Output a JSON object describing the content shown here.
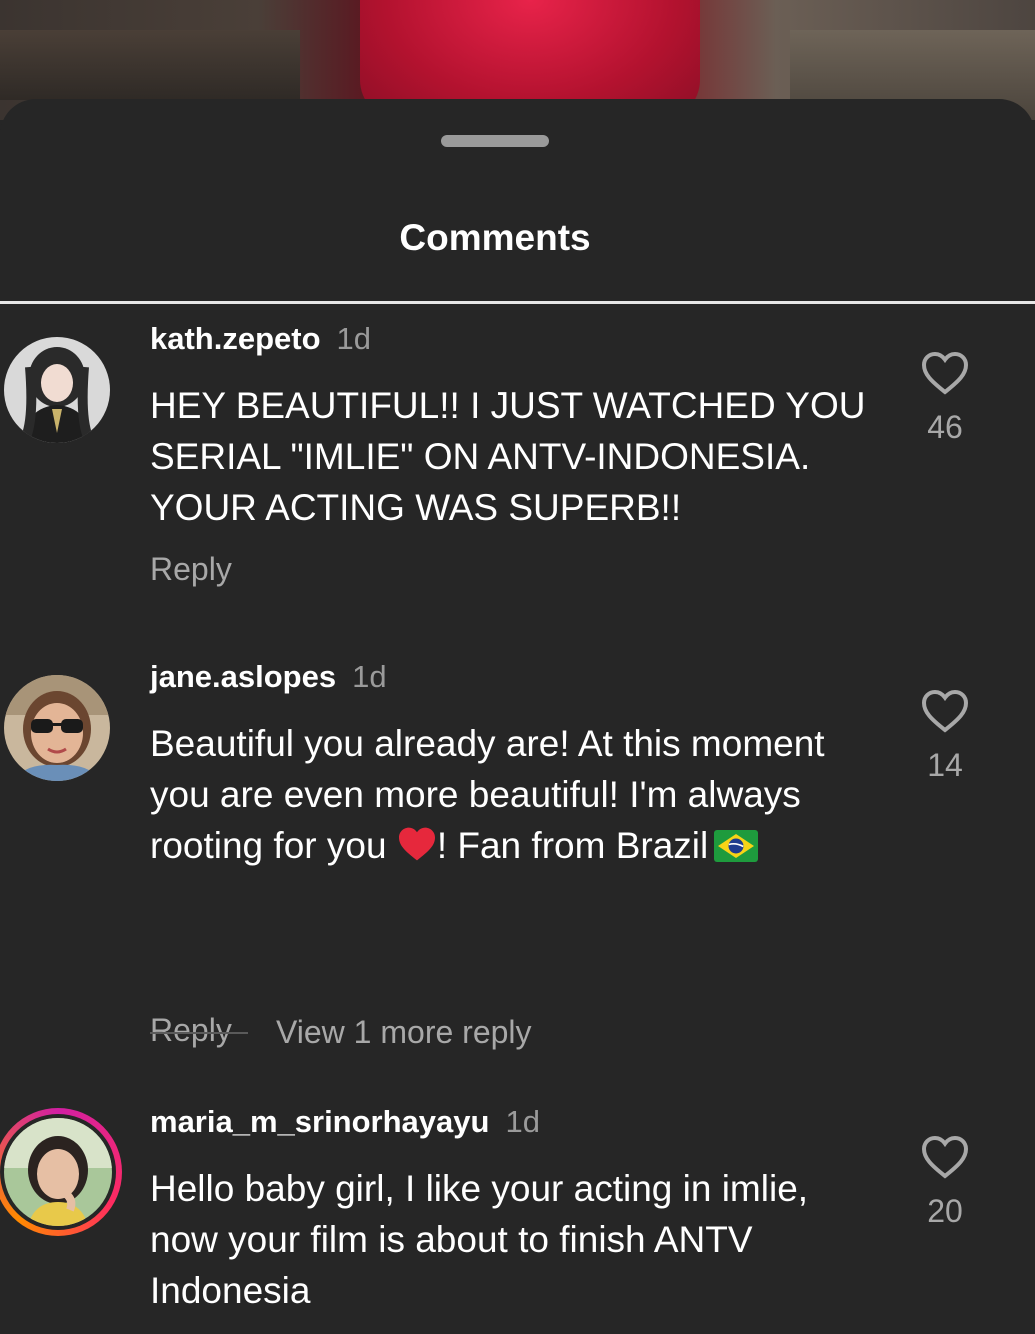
{
  "sheet": {
    "title": "Comments"
  },
  "comments": [
    {
      "username": "kath.zepeto",
      "time": "1d",
      "text": "HEY BEAUTIFUL!! I JUST WATCHED YOU SERIAL \"IMLIE\" ON ANTV-INDONESIA. YOUR ACTING WAS SUPERB!!",
      "reply_label": "Reply",
      "likes": "46"
    },
    {
      "username": "jane.aslopes",
      "time": "1d",
      "text_part1": "Beautiful you already are! At this moment you are even more beautiful! I'm always rooting for you ",
      "text_part2": "! Fan from Brazil",
      "reply_label": "Reply",
      "likes": "14",
      "view_more": "View 1 more reply"
    },
    {
      "username": "maria_m_srinorhayayu",
      "time": "1d",
      "text": "Hello baby girl, I like your acting in imlie, now your film is about to finish ANTV Indonesia",
      "likes": "20"
    }
  ],
  "icons": {
    "like": "heart-outline-icon",
    "emoji_heart": "red-heart-emoji",
    "emoji_flag": "brazil-flag-emoji"
  },
  "colors": {
    "sheet_bg": "#262626",
    "text_primary": "#ffffff",
    "text_secondary": "#a8a8a8",
    "story_ring_start": "#d11fa3",
    "story_ring_end": "#ff8a00"
  }
}
